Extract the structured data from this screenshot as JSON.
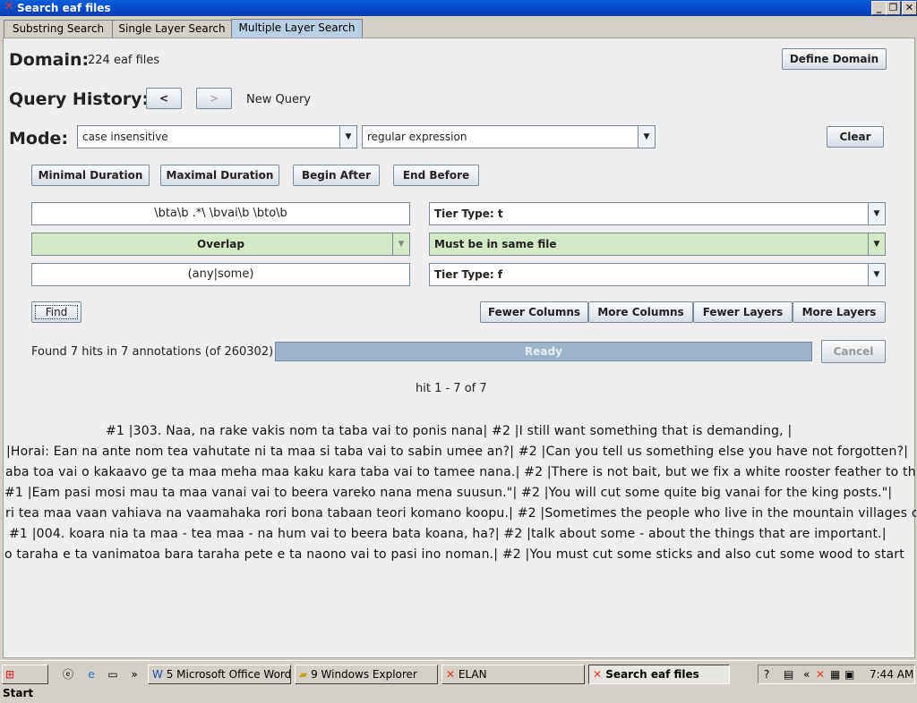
{
  "window": {
    "title": "Search eaf files"
  },
  "tabs": [
    {
      "label": "Substring Search"
    },
    {
      "label": "Single Layer Search"
    },
    {
      "label": "Multiple Layer Search"
    }
  ],
  "domain": {
    "label": "Domain:",
    "value": "224 eaf files",
    "button": "Define Domain"
  },
  "history": {
    "label": "Query History:",
    "prev": "<",
    "next": ">",
    "status": "New Query"
  },
  "mode": {
    "label": "Mode:",
    "case": "case insensitive",
    "type": "regular expression",
    "clear": "Clear"
  },
  "constraints": [
    "Minimal Duration",
    "Maximal Duration",
    "Begin After",
    "End Before"
  ],
  "query": {
    "pattern1": "\\bta\\b .*\\ \\bvai\\b \\bto\\b",
    "tier1": "Tier Type: t",
    "relation": "Overlap",
    "file_constraint": "Must be in same file",
    "pattern2": "(any|some)",
    "tier2": "Tier Type: f"
  },
  "actions": {
    "find": "Find",
    "fewer_columns": "Fewer Columns",
    "more_columns": "More Columns",
    "fewer_layers": "Fewer Layers",
    "more_layers": "More Layers"
  },
  "status": {
    "found": "Found 7 hits in 7 annotations (of 260302)",
    "progress": "Ready",
    "progress_value": 1.0,
    "cancel": "Cancel"
  },
  "results": {
    "range": "hit 1 - 7 of 7",
    "lines": [
      "#1 |303. Naa, na rake vakis nom ta taba vai to ponis nana|  #2 |I still want something that is demanding, |",
      "|Horai: Ean na ante nom tea vahutate ni ta maa si taba vai to sabin umee an?|  #2 |Can you tell us something else you have not forgotten?|",
      "aba toa vai o kakaavo ge ta maa meha maa kaku kara taba vai to tamee nana.|  #2 |There is not bait, but we fix a white rooster feather to th",
      "#1 |Eam pasi mosi mau ta maa vanai vai to beera vareko nana mena suusun.\"|  #2 |You will cut some quite big vanai for the king posts.\"|",
      "ri tea maa vaan vahiava na vaamahaka rori bona tabaan teori komano koopu.|  #2 |Sometimes the people who live in the mountain villages c",
      "#1 |004. koara nia ta maa - tea maa - na hum vai to beera bata koana, ha?|  #2 |talk about some - about the things that are important.|",
      "o taraha e ta vanimatoa bara taraha pete e ta naono vai to pasi ino noman.|  #2 |You must cut some sticks and also cut some wood to start"
    ]
  },
  "taskbar": {
    "start": "Start",
    "tasks": [
      {
        "label": "5 Microsoft Office Word"
      },
      {
        "label": "9 Windows Explorer"
      },
      {
        "label": "ELAN"
      },
      {
        "label": "Search eaf files"
      }
    ],
    "clock": "7:44 AM"
  }
}
